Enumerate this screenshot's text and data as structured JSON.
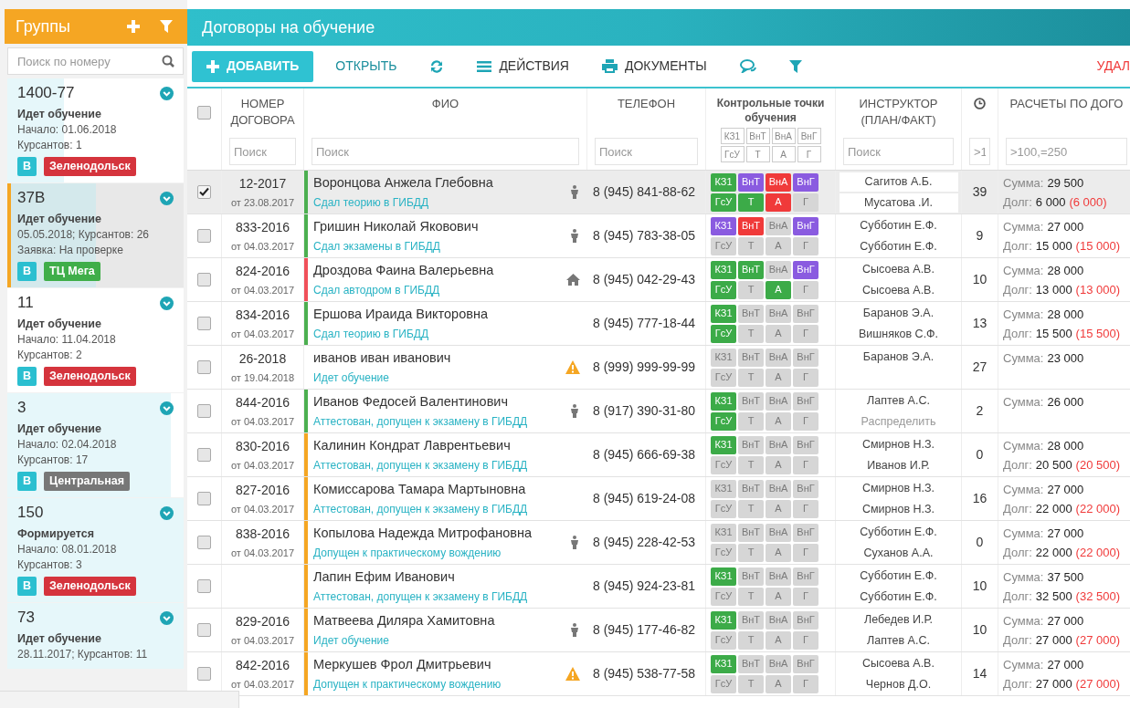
{
  "sidebar": {
    "title": "Группы",
    "search": {
      "placeholder": "Поиск по номеру"
    },
    "groups": [
      {
        "number": "1400-77",
        "status": "Идет обучение",
        "lines": [
          "Начало: 01.06.2018",
          "Курсантов: 1"
        ],
        "level": 0.32,
        "selected": false,
        "tags": [
          {
            "label": "В",
            "color": "#2bbfd0"
          },
          {
            "label": "Зеленодольск",
            "color": "#d5343d"
          }
        ]
      },
      {
        "number": "37В",
        "status": "Идет обучение",
        "lines": [
          "05.05.2018; Курсантов: 26",
          "Заявка: На проверке"
        ],
        "level": 0.49,
        "selected": true,
        "tags": [
          {
            "label": "В",
            "color": "#2bbfd0"
          },
          {
            "label": "ТЦ Мега",
            "color": "#3fae49"
          }
        ]
      },
      {
        "number": "11",
        "status": "Идет обучение",
        "lines": [
          "Начало: 11.04.2018",
          "Курсантов: 2"
        ],
        "selected": false,
        "tags": [
          {
            "label": "В",
            "color": "#2bbfd0"
          },
          {
            "label": "Зеленодольск",
            "color": "#d5343d"
          }
        ]
      },
      {
        "number": "3",
        "status": "Идет обучение",
        "lines": [
          "Начало: 02.04.2018",
          "Курсантов: 17"
        ],
        "level": 0.93,
        "selected": false,
        "tags": [
          {
            "label": "В",
            "color": "#2bbfd0"
          },
          {
            "label": "Центральная",
            "color": "#777777"
          }
        ]
      },
      {
        "number": "150",
        "status": "Формируется",
        "lines": [
          "Начало: 08.01.2018",
          "Курсантов: 3"
        ],
        "level": 1,
        "selected": false,
        "tags": [
          {
            "label": "В",
            "color": "#2bbfd0"
          },
          {
            "label": "Зеленодольск",
            "color": "#d5343d"
          }
        ]
      },
      {
        "number": "73",
        "status": "Идет обучение",
        "lines": [
          "28.11.2017; Курсантов: 11"
        ],
        "level": 1,
        "selected": false
      }
    ]
  },
  "page_title": "Договоры на обучение",
  "toolbar": [
    {
      "kind": "add",
      "label": "ДОБАВИТЬ"
    },
    {
      "kind": "open",
      "label": "ОТКРЫТЬ"
    },
    {
      "kind": "refresh"
    },
    {
      "kind": "actions",
      "label": "ДЕЙСТВИЯ"
    },
    {
      "kind": "documents",
      "label": "ДОКУМЕНТЫ"
    },
    {
      "kind": "chat"
    },
    {
      "kind": "filter"
    },
    {
      "kind": "delete",
      "label": "УДАЛ"
    }
  ],
  "table": {
    "header_checkbox": {
      "checked": false
    },
    "columns": [
      {
        "kind": "text",
        "label": "НОМЕР ДОГОВОРА",
        "placeholder": "Поиск"
      },
      {
        "kind": "text",
        "label": "ФИО",
        "placeholder": "Поиск"
      },
      {
        "kind": "text",
        "label": "ТЕЛЕФОН",
        "placeholder": "Поиск"
      },
      {
        "kind": "checkpoints",
        "label": "Контрольные точки обучения",
        "checkpoints": [
          "КЗ1",
          "ВнТ",
          "ВнА",
          "ВнГ",
          "ГсУ",
          "Т",
          "А",
          "Г"
        ]
      },
      {
        "kind": "text",
        "label": "ИНСТРУКТОР (ПЛАН/ФАКТ)",
        "placeholder": "Поиск"
      },
      {
        "kind": "hours",
        "placeholder": ">1"
      },
      {
        "kind": "text",
        "label": "РАСЧЕТЫ ПО ДОГО",
        "placeholder": ">100,=250"
      }
    ],
    "rows": [
      {
        "selected": true,
        "number": "12-2017",
        "date": "от 23.08.2017",
        "name": "Воронцова Анжела Глебовна",
        "stage": "Сдал теорию в ГИБДД",
        "color": "#4caf50",
        "kind": "driver",
        "phone": "8 (945) 841-88-62",
        "checkpoints": [
          {
            "label": "КЗ1",
            "color": "#3cab48"
          },
          {
            "label": "ВнТ",
            "color": "#8a5be0"
          },
          {
            "label": "ВнА",
            "color": "#f03a3a"
          },
          {
            "label": "ВнГ",
            "color": "#8a5be0"
          },
          {
            "label": "ГсУ",
            "color": "#3cab48"
          },
          {
            "label": "Т",
            "color": "#3cab48"
          },
          {
            "label": "А",
            "color": "#f03a3a"
          },
          {
            "label": "Г",
            "color": "#d6d6d6"
          }
        ],
        "instructors": [
          {
            "text": "Сагитов А.Б.",
            "assigned": true
          },
          {
            "text": "Мусатова .И.",
            "assigned": true
          }
        ],
        "hours": "39",
        "sum_label": "Сумма:",
        "sum": "29 500",
        "debt_label": "Долг:",
        "debt": "6 000",
        "overdue": "(6 000)"
      },
      {
        "selected": false,
        "number": "833-2016",
        "date": "от 04.03.2017",
        "name": "Гришин Николай Яковович",
        "stage": "Сдал экзамены в ГИБДД",
        "color": "#4caf50",
        "kind": "driver",
        "phone": "8 (945) 783-38-05",
        "checkpoints": [
          {
            "label": "КЗ1",
            "color": "#8a5be0"
          },
          {
            "label": "ВнТ",
            "color": "#f03a3a"
          },
          {
            "label": "ВнА",
            "color": "#d6d6d6"
          },
          {
            "label": "ВнГ",
            "color": "#8a5be0"
          },
          {
            "label": "ГсУ",
            "color": "#d6d6d6"
          },
          {
            "label": "Т",
            "color": "#d6d6d6"
          },
          {
            "label": "А",
            "color": "#d6d6d6"
          },
          {
            "label": "Г",
            "color": "#d6d6d6"
          }
        ],
        "instructors": [
          {
            "text": "Субботин Е.Ф.",
            "assigned": true
          },
          {
            "text": "Субботин Е.Ф.",
            "assigned": true
          }
        ],
        "hours": "9",
        "sum_label": "Сумма:",
        "sum": "27 000",
        "debt_label": "Долг:",
        "debt": "15 000",
        "overdue": "(15 000)"
      },
      {
        "selected": false,
        "number": "824-2016",
        "date": "от 04.03.2017",
        "name": "Дроздова Фаина Валерьевна",
        "stage": "Сдал автодром в ГИБДД",
        "color": "#f0505a",
        "kind": "home",
        "phone": "8 (945) 042-29-43",
        "checkpoints": [
          {
            "label": "КЗ1",
            "color": "#3cab48"
          },
          {
            "label": "ВнТ",
            "color": "#3cab48"
          },
          {
            "label": "ВнА",
            "color": "#d6d6d6"
          },
          {
            "label": "ВнГ",
            "color": "#8a5be0"
          },
          {
            "label": "ГсУ",
            "color": "#3cab48"
          },
          {
            "label": "Т",
            "color": "#d6d6d6"
          },
          {
            "label": "А",
            "color": "#3cab48"
          },
          {
            "label": "Г",
            "color": "#d6d6d6"
          }
        ],
        "instructors": [
          {
            "text": "Сысоева А.В.",
            "assigned": true
          },
          {
            "text": "Сысоева А.В.",
            "assigned": true
          }
        ],
        "hours": "10",
        "sum_label": "Сумма:",
        "sum": "28 000",
        "debt_label": "Долг:",
        "debt": "13 000",
        "overdue": "(13 000)"
      },
      {
        "selected": false,
        "number": "834-2016",
        "date": "от 04.03.2017",
        "name": "Ершова Ираида Викторовна",
        "stage": "Сдал теорию в ГИБДД",
        "color": "#4caf50",
        "kind": "plain",
        "phone": "8 (945) 777-18-44",
        "checkpoints": [
          {
            "label": "КЗ1",
            "color": "#3cab48"
          },
          {
            "label": "ВнТ",
            "color": "#d6d6d6"
          },
          {
            "label": "ВнА",
            "color": "#d6d6d6"
          },
          {
            "label": "ВнГ",
            "color": "#d6d6d6"
          },
          {
            "label": "ГсУ",
            "color": "#3cab48"
          },
          {
            "label": "Т",
            "color": "#d6d6d6"
          },
          {
            "label": "А",
            "color": "#d6d6d6"
          },
          {
            "label": "Г",
            "color": "#d6d6d6"
          }
        ],
        "instructors": [
          {
            "text": "Баранов Э.А.",
            "assigned": true
          },
          {
            "text": "Вишняков С.Ф.",
            "assigned": true
          }
        ],
        "hours": "13",
        "sum_label": "Сумма:",
        "sum": "28 000",
        "debt_label": "Долг:",
        "debt": "15 500",
        "overdue": "(15 500)"
      },
      {
        "selected": false,
        "number": "26-2018",
        "date": "от 19.04.2018",
        "name": "иванов иван иванович",
        "stage": "Идет обучение",
        "kind": "warning",
        "phone": "8 (999) 999-99-99",
        "checkpoints": [
          {
            "label": "КЗ1",
            "color": "#d6d6d6"
          },
          {
            "label": "ВнТ",
            "color": "#d6d6d6"
          },
          {
            "label": "ВнА",
            "color": "#d6d6d6"
          },
          {
            "label": "ВнГ",
            "color": "#d6d6d6"
          },
          {
            "label": "ГсУ",
            "color": "#d6d6d6"
          },
          {
            "label": "Т",
            "color": "#d6d6d6"
          },
          {
            "label": "А",
            "color": "#d6d6d6"
          },
          {
            "label": "Г",
            "color": "#d6d6d6"
          }
        ],
        "instructors": [
          {
            "text": "Баранов Э.А.",
            "assigned": true
          }
        ],
        "hours": "27",
        "sum_label": "Сумма:",
        "sum": "23 000"
      },
      {
        "selected": false,
        "number": "844-2016",
        "date": "от 04.03.2017",
        "name": "Иванов Федосей Валентинович",
        "stage": "Аттестован, допущен к экзамену в ГИБДД",
        "color": "#4caf50",
        "kind": "driver",
        "phone": "8 (917) 390-31-80",
        "checkpoints": [
          {
            "label": "КЗ1",
            "color": "#3cab48"
          },
          {
            "label": "ВнТ",
            "color": "#d6d6d6"
          },
          {
            "label": "ВнА",
            "color": "#d6d6d6"
          },
          {
            "label": "ВнГ",
            "color": "#d6d6d6"
          },
          {
            "label": "ГсУ",
            "color": "#3cab48"
          },
          {
            "label": "Т",
            "color": "#d6d6d6"
          },
          {
            "label": "А",
            "color": "#d6d6d6"
          },
          {
            "label": "Г",
            "color": "#d6d6d6"
          }
        ],
        "instructors": [
          {
            "text": "Лаптев А.С.",
            "assigned": true
          },
          {
            "text": "Распределить",
            "assigned": false
          }
        ],
        "hours": "2",
        "sum_label": "Сумма:",
        "sum": "26 000"
      },
      {
        "selected": false,
        "number": "830-2016",
        "date": "от 04.03.2017",
        "name": "Калинин Кондрат Лаврентьевич",
        "stage": "Аттестован, допущен к экзамену в ГИБДД",
        "color": "#f5a623",
        "kind": "plain",
        "phone": "8 (945) 666-69-38",
        "checkpoints": [
          {
            "label": "КЗ1",
            "color": "#3cab48"
          },
          {
            "label": "ВнТ",
            "color": "#d6d6d6"
          },
          {
            "label": "ВнА",
            "color": "#d6d6d6"
          },
          {
            "label": "ВнГ",
            "color": "#d6d6d6"
          },
          {
            "label": "ГсУ",
            "color": "#d6d6d6"
          },
          {
            "label": "Т",
            "color": "#d6d6d6"
          },
          {
            "label": "А",
            "color": "#d6d6d6"
          },
          {
            "label": "Г",
            "color": "#d6d6d6"
          }
        ],
        "instructors": [
          {
            "text": "Смирнов Н.З.",
            "assigned": true
          },
          {
            "text": "Иванов И.Р.",
            "assigned": true
          }
        ],
        "hours": "0",
        "sum_label": "Сумма:",
        "sum": "28 000",
        "debt_label": "Долг:",
        "debt": "20 500",
        "overdue": "(20 500)"
      },
      {
        "selected": false,
        "number": "827-2016",
        "date": "от 04.03.2017",
        "name": "Комиссарова Тамара Мартыновна",
        "stage": "Аттестован, допущен к экзамену в ГИБДД",
        "color": "#f5a623",
        "kind": "plain",
        "phone": "8 (945) 619-24-08",
        "checkpoints": [
          {
            "label": "КЗ1",
            "color": "#d6d6d6"
          },
          {
            "label": "ВнТ",
            "color": "#d6d6d6"
          },
          {
            "label": "ВнА",
            "color": "#d6d6d6"
          },
          {
            "label": "ВнГ",
            "color": "#d6d6d6"
          },
          {
            "label": "ГсУ",
            "color": "#d6d6d6"
          },
          {
            "label": "Т",
            "color": "#d6d6d6"
          },
          {
            "label": "А",
            "color": "#d6d6d6"
          },
          {
            "label": "Г",
            "color": "#d6d6d6"
          }
        ],
        "instructors": [
          {
            "text": "Смирнов Н.З.",
            "assigned": true
          },
          {
            "text": "Смирнов Н.З.",
            "assigned": true
          }
        ],
        "hours": "16",
        "sum_label": "Сумма:",
        "sum": "27 000",
        "debt_label": "Долг:",
        "debt": "22 000",
        "overdue": "(22 000)"
      },
      {
        "selected": false,
        "number": "838-2016",
        "date": "от 04.03.2017",
        "name": "Копылова Надежда Митрофановна",
        "stage": "Допущен к практическому вождению",
        "color": "#f5a623",
        "kind": "driver",
        "phone": "8 (945) 228-42-53",
        "checkpoints": [
          {
            "label": "КЗ1",
            "color": "#d6d6d6"
          },
          {
            "label": "ВнТ",
            "color": "#d6d6d6"
          },
          {
            "label": "ВнА",
            "color": "#d6d6d6"
          },
          {
            "label": "ВнГ",
            "color": "#d6d6d6"
          },
          {
            "label": "ГсУ",
            "color": "#d6d6d6"
          },
          {
            "label": "Т",
            "color": "#d6d6d6"
          },
          {
            "label": "А",
            "color": "#d6d6d6"
          },
          {
            "label": "Г",
            "color": "#d6d6d6"
          }
        ],
        "instructors": [
          {
            "text": "Субботин Е.Ф.",
            "assigned": true
          },
          {
            "text": "Суханов А.А.",
            "assigned": true
          }
        ],
        "hours": "0",
        "sum_label": "Сумма:",
        "sum": "27 000",
        "debt_label": "Долг:",
        "debt": "22 000",
        "overdue": "(22 000)"
      },
      {
        "selected": false,
        "name": "Лапин Ефим Иванович",
        "stage": "Аттестован, допущен к экзамену в ГИБДД",
        "color": "#f5a623",
        "kind": "plain",
        "phone": "8 (945) 924-23-81",
        "checkpoints": [
          {
            "label": "КЗ1",
            "color": "#3cab48"
          },
          {
            "label": "ВнТ",
            "color": "#d6d6d6"
          },
          {
            "label": "ВнА",
            "color": "#d6d6d6"
          },
          {
            "label": "ВнГ",
            "color": "#d6d6d6"
          },
          {
            "label": "ГсУ",
            "color": "#d6d6d6"
          },
          {
            "label": "Т",
            "color": "#d6d6d6"
          },
          {
            "label": "А",
            "color": "#d6d6d6"
          },
          {
            "label": "Г",
            "color": "#d6d6d6"
          }
        ],
        "instructors": [
          {
            "text": "Субботин Е.Ф.",
            "assigned": true
          },
          {
            "text": "Субботин Е.Ф.",
            "assigned": true
          }
        ],
        "hours": "10",
        "sum_label": "Сумма:",
        "sum": "37 500",
        "debt_label": "Долг:",
        "debt": "32 500",
        "overdue": "(32 500)"
      },
      {
        "selected": false,
        "number": "829-2016",
        "date": "от 04.03.2017",
        "name": "Матвеева Диляра Хамитовна",
        "stage": "Идет обучение",
        "color": "#f5a623",
        "kind": "driver",
        "phone": "8 (945) 177-46-82",
        "checkpoints": [
          {
            "label": "КЗ1",
            "color": "#3cab48"
          },
          {
            "label": "ВнТ",
            "color": "#d6d6d6"
          },
          {
            "label": "ВнА",
            "color": "#d6d6d6"
          },
          {
            "label": "ВнГ",
            "color": "#d6d6d6"
          },
          {
            "label": "ГсУ",
            "color": "#d6d6d6"
          },
          {
            "label": "Т",
            "color": "#d6d6d6"
          },
          {
            "label": "А",
            "color": "#d6d6d6"
          },
          {
            "label": "Г",
            "color": "#d6d6d6"
          }
        ],
        "instructors": [
          {
            "text": "Лебедев И.Р.",
            "assigned": true
          },
          {
            "text": "Лаптев А.С.",
            "assigned": true
          }
        ],
        "hours": "10",
        "sum_label": "Сумма:",
        "sum": "27 000",
        "debt_label": "Долг:",
        "debt": "27 000",
        "overdue": "(27 000)"
      },
      {
        "selected": false,
        "number": "842-2016",
        "date": "от 04.03.2017",
        "name": "Меркушев Фрол Дмитрьевич",
        "stage": "Допущен к практическому вождению",
        "color": "#f5a623",
        "kind": "warning",
        "phone": "8 (945) 538-77-58",
        "checkpoints": [
          {
            "label": "КЗ1",
            "color": "#3cab48"
          },
          {
            "label": "ВнТ",
            "color": "#d6d6d6"
          },
          {
            "label": "ВнА",
            "color": "#d6d6d6"
          },
          {
            "label": "ВнГ",
            "color": "#d6d6d6"
          },
          {
            "label": "ГсУ",
            "color": "#d6d6d6"
          },
          {
            "label": "Т",
            "color": "#d6d6d6"
          },
          {
            "label": "А",
            "color": "#d6d6d6"
          },
          {
            "label": "Г",
            "color": "#d6d6d6"
          }
        ],
        "instructors": [
          {
            "text": "Сысоева А.В.",
            "assigned": true
          },
          {
            "text": "Чернов Д.О.",
            "assigned": true
          }
        ],
        "hours": "14",
        "sum_label": "Сумма:",
        "sum": "27 000",
        "debt_label": "Долг:",
        "debt": "27 000",
        "overdue": "(27 000)"
      }
    ]
  }
}
